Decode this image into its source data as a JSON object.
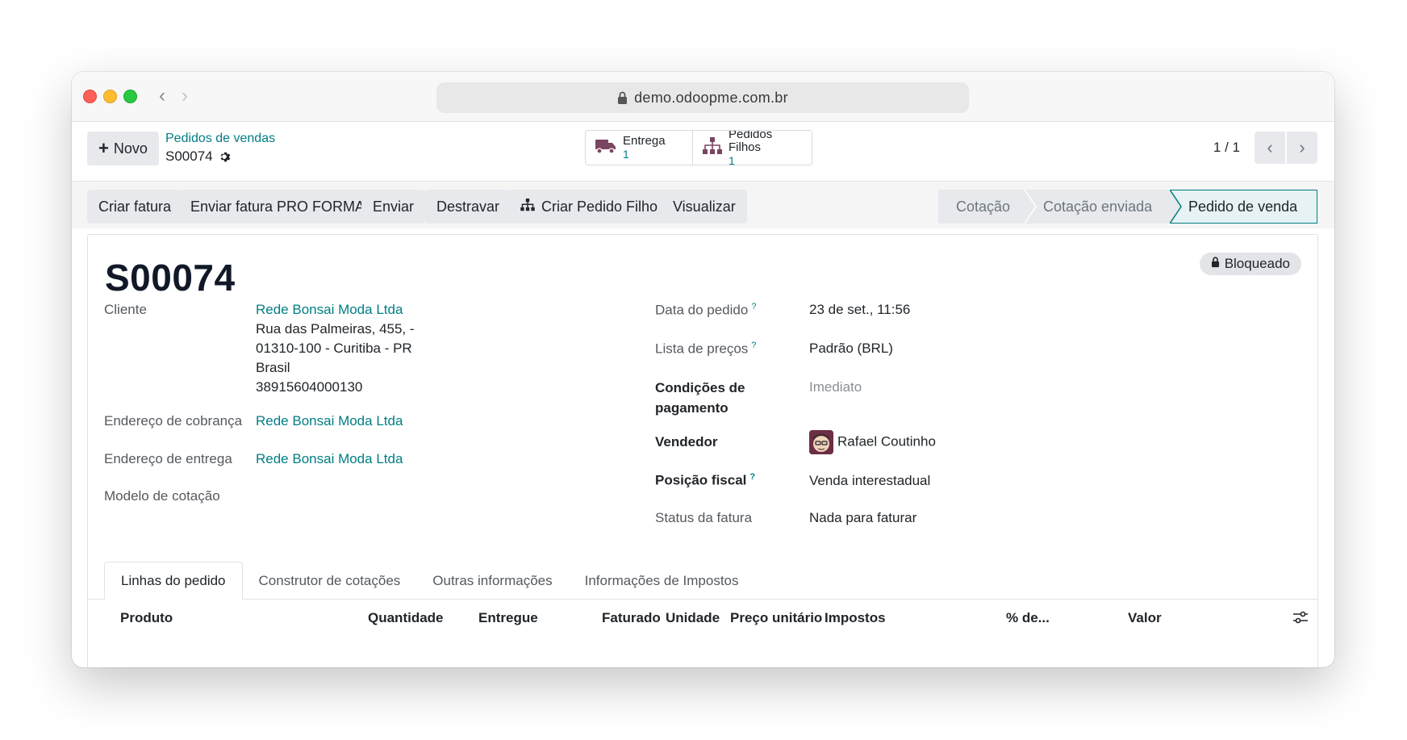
{
  "browser": {
    "url": "demo.odoopme.com.br"
  },
  "control": {
    "new_label": "Novo",
    "breadcrumb_parent": "Pedidos de vendas",
    "breadcrumb_current": "S00074",
    "smart_buttons": [
      {
        "label": "Entrega",
        "value": "1",
        "icon": "truck-icon"
      },
      {
        "label": "Pedidos Filhos",
        "value": "1",
        "icon": "sitemap-icon"
      }
    ],
    "pager": "1 / 1"
  },
  "actions": {
    "buttons": [
      "Criar fatura",
      "Enviar fatura PRO FORMA",
      "Enviar",
      "Destravar",
      "Criar Pedido Filho",
      "Visualizar"
    ],
    "stages": [
      "Cotação",
      "Cotação enviada",
      "Pedido de venda"
    ],
    "active_stage": "Pedido de venda"
  },
  "sheet": {
    "title": "S00074",
    "ribbon": "Bloqueado",
    "left_fields": {
      "cliente_label": "Cliente",
      "cliente_name": "Rede Bonsai Moda Ltda",
      "cliente_addr1": "Rua das Palmeiras, 455, -",
      "cliente_addr2": "01310-100 - Curitiba - PR",
      "cliente_addr3": "Brasil",
      "cliente_addr4": "38915604000130",
      "cobranca_label": "Endereço de cobrança",
      "cobranca_value": "Rede Bonsai Moda Ltda",
      "entrega_label": "Endereço de entrega",
      "entrega_value": "Rede Bonsai Moda Ltda",
      "modelo_label": "Modelo de cotação"
    },
    "right_fields": {
      "data_label": "Data do pedido",
      "data_value": "23 de set., 11:56",
      "lista_label": "Lista de preços",
      "lista_value": "Padrão (BRL)",
      "condicoes_label_1": "Condições de",
      "condicoes_label_2": "pagamento",
      "condicoes_value": "Imediato",
      "vendedor_label": "Vendedor",
      "vendedor_value": "Rafael Coutinho",
      "posicao_label": "Posição fiscal",
      "posicao_value": "Venda interestadual",
      "status_label": "Status da fatura",
      "status_value": "Nada para faturar"
    },
    "help_mark": "?",
    "tabs": [
      "Linhas do pedido",
      "Construtor de cotações",
      "Outras informações",
      "Informações de Impostos"
    ],
    "active_tab": "Linhas do pedido",
    "columns": [
      "Produto",
      "Quantidade",
      "Entregue",
      "Faturado",
      "Unidade",
      "Preço unitário",
      "Impostos",
      "% de...",
      "Valor"
    ]
  },
  "colors": {
    "accent": "#017e84",
    "button_bg": "#e7e9ed",
    "active_stage_bg": "#e6f2f3"
  }
}
